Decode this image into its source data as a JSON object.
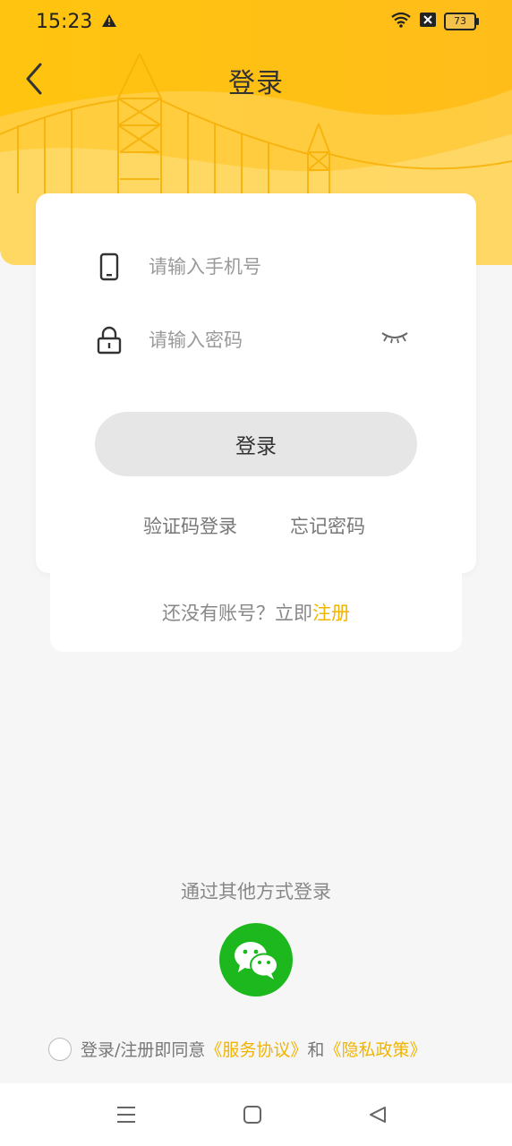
{
  "status_bar": {
    "time": "15:23",
    "battery": "73"
  },
  "header": {
    "title": "登录"
  },
  "form": {
    "phone_placeholder": "请输入手机号",
    "password_placeholder": "请输入密码",
    "login_button": "登录",
    "sms_login": "验证码登录",
    "forgot_password": "忘记密码"
  },
  "register": {
    "prompt": "还没有账号？立即",
    "link": "注册"
  },
  "other_login": {
    "title": "通过其他方式登录"
  },
  "agreement": {
    "prefix": "登录/注册即同意",
    "service": "《服务协议》",
    "and": "和",
    "privacy": "《隐私政策》"
  },
  "colors": {
    "accent": "#f1b400",
    "header_yellow": "#ffc21a",
    "wechat_green": "#1db81d"
  }
}
